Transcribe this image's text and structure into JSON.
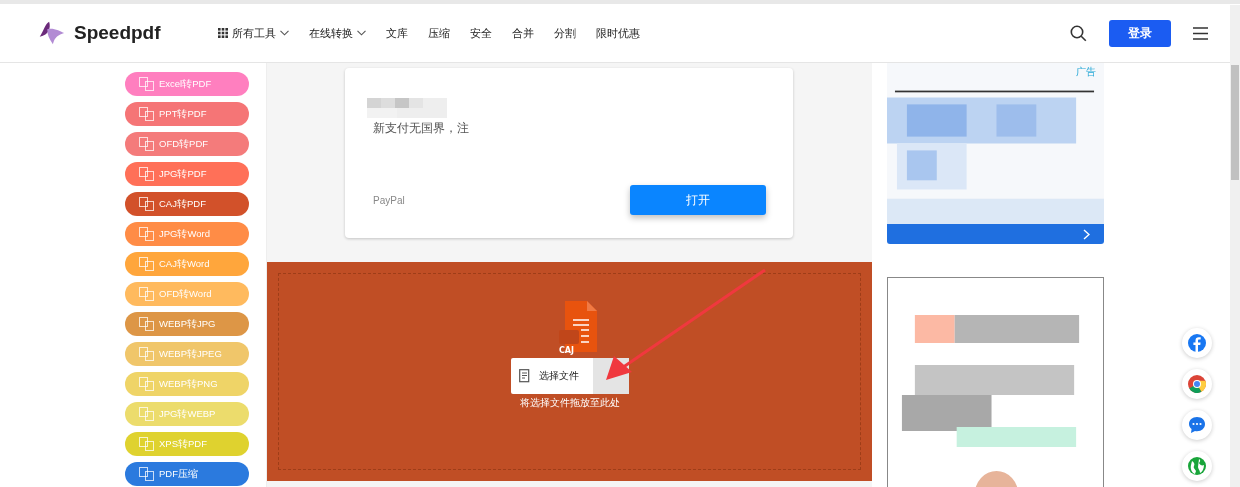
{
  "header": {
    "brand": "Speedpdf",
    "nav": [
      {
        "label": "所有工具",
        "dropdown": true
      },
      {
        "label": "在线转换",
        "dropdown": true
      },
      {
        "label": "文库",
        "dropdown": false
      },
      {
        "label": "压缩",
        "dropdown": false
      },
      {
        "label": "安全",
        "dropdown": false
      },
      {
        "label": "合并",
        "dropdown": false
      },
      {
        "label": "分割",
        "dropdown": false
      },
      {
        "label": "限时优惠",
        "dropdown": false
      }
    ],
    "login": "登录"
  },
  "sidebar": {
    "tools": [
      {
        "label": "Excel转PDF",
        "color": "#ff7fbf"
      },
      {
        "label": "PPT转PDF",
        "color": "#f57576"
      },
      {
        "label": "OFD转PDF",
        "color": "#f47b7b"
      },
      {
        "label": "JPG转PDF",
        "color": "#ff7058"
      },
      {
        "label": "CAJ转PDF",
        "color": "#d2512a"
      },
      {
        "label": "JPG转Word",
        "color": "#ff8c46"
      },
      {
        "label": "CAJ转Word",
        "color": "#ffa63c"
      },
      {
        "label": "OFD转Word",
        "color": "#ffba5e"
      },
      {
        "label": "WEBP转JPG",
        "color": "#dd9646"
      },
      {
        "label": "WEBP转JPEG",
        "color": "#f0c66a"
      },
      {
        "label": "WEBP转PNG",
        "color": "#efd467"
      },
      {
        "label": "JPG转WEBP",
        "color": "#ecdc6c"
      },
      {
        "label": "XPS转PDF",
        "color": "#dfd22f"
      },
      {
        "label": "PDF压缩",
        "color": "#2b7ade"
      }
    ]
  },
  "ad_card": {
    "text": "新支付无国界，注",
    "source": "PayPal",
    "button": "打开"
  },
  "upload": {
    "file_badge": "CAJ",
    "button": "选择文件",
    "hint": "将选择文件拖放至此处"
  },
  "side_ad": {
    "label": "广告"
  }
}
